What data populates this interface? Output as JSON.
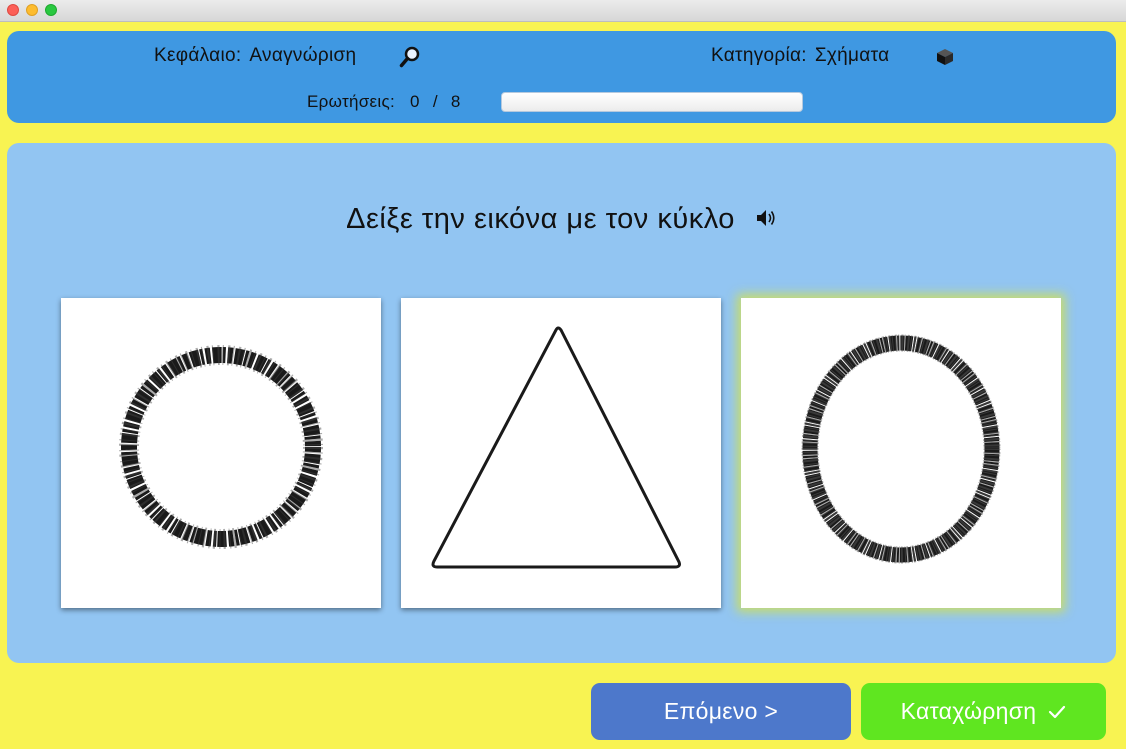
{
  "header": {
    "chapter_label": "Κεφάλαιο:",
    "chapter_value": "Αναγνώριση",
    "chapter_icon": "magnifier-icon",
    "category_label": "Κατηγορία:",
    "category_value": "Σχήματα",
    "category_icon": "cube-icon",
    "questions_label": "Ερωτήσεις:",
    "questions_current": "0",
    "questions_sep": "/",
    "questions_total": "8",
    "progress_fraction": 0
  },
  "question": {
    "text": "Δείξε την εικόνα με τον κύκλο",
    "audio_icon": "speaker-icon"
  },
  "choices": [
    {
      "shape": "circle",
      "selected": false
    },
    {
      "shape": "triangle",
      "selected": false
    },
    {
      "shape": "oval",
      "selected": true
    }
  ],
  "buttons": {
    "next_label": "Επόμενο >",
    "submit_label": "Καταχώρηση"
  },
  "colors": {
    "background": "#f8f352",
    "header": "#3f98e2",
    "panel": "#92c5f2",
    "next_button": "#4d78cb",
    "submit_button": "#5fe620"
  }
}
